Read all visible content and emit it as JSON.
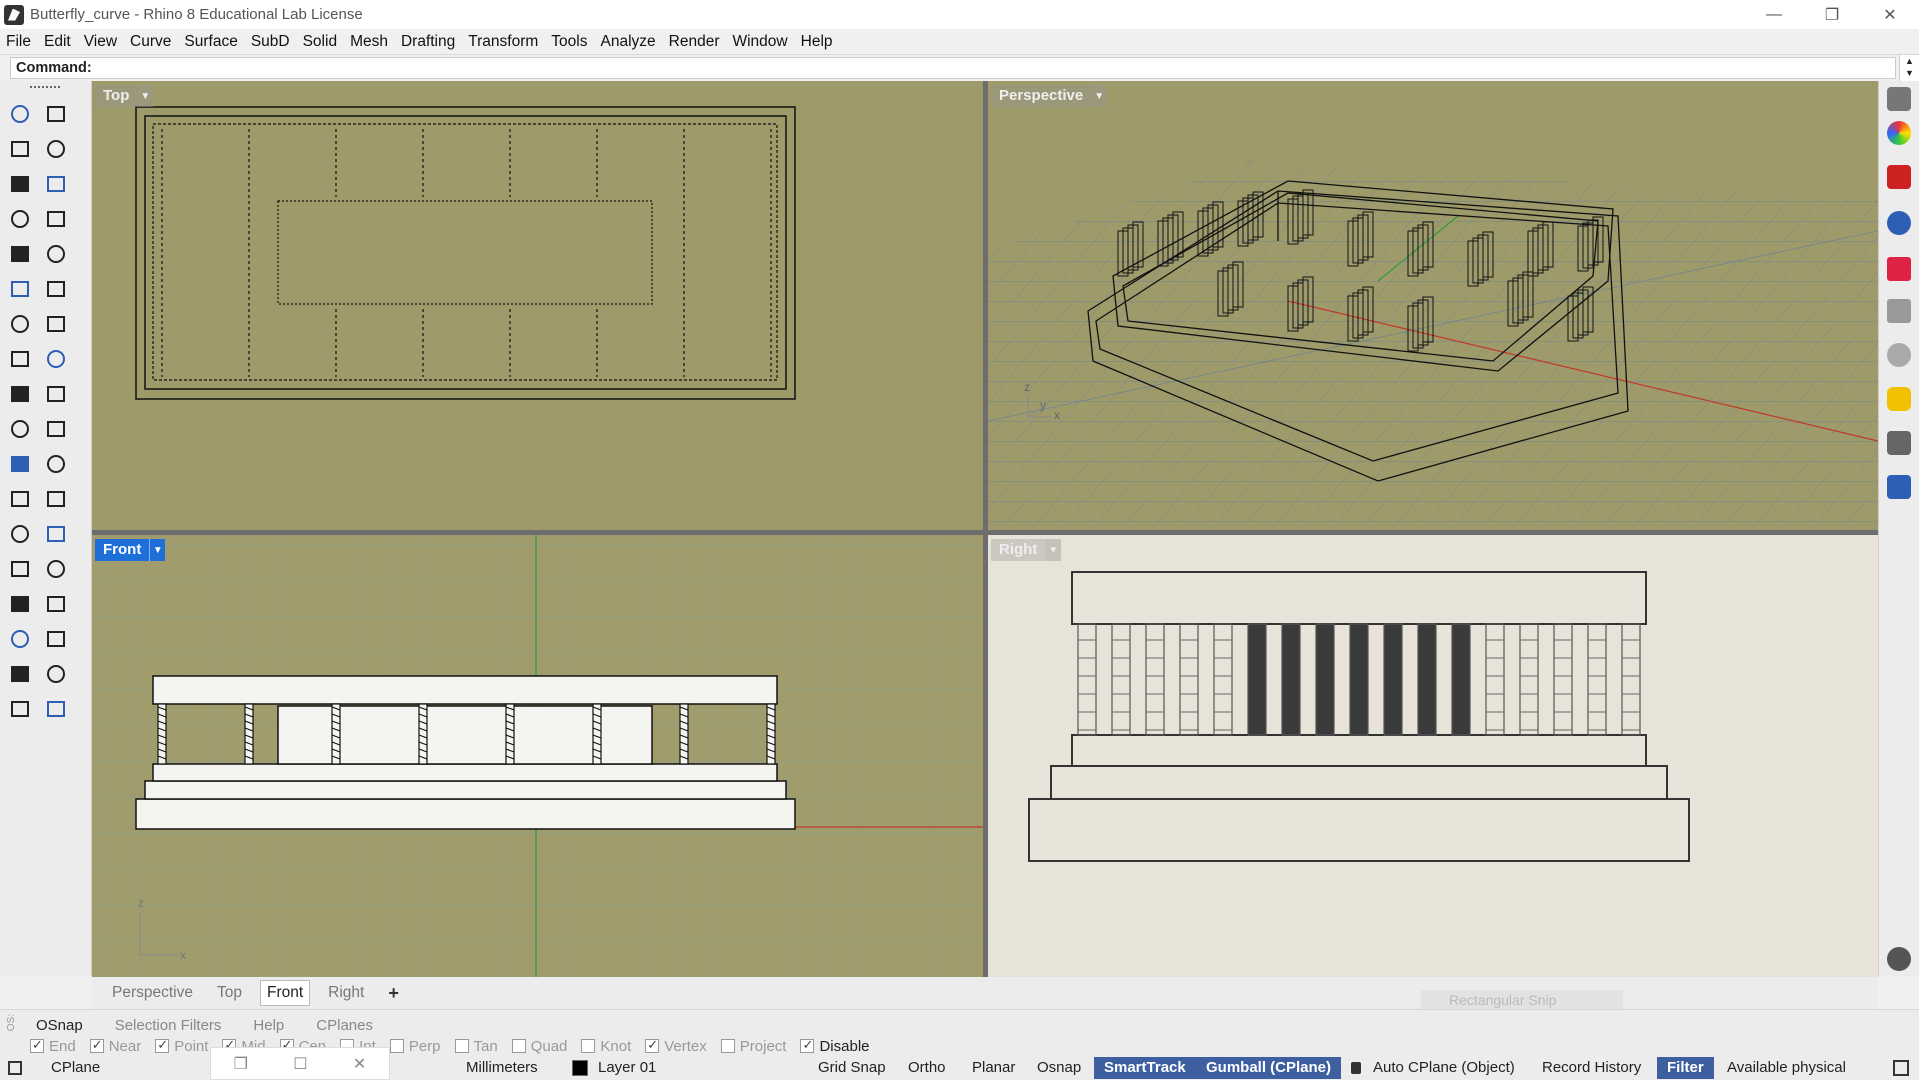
{
  "window": {
    "title": "Butterfly_curve - Rhino 8 Educational Lab License",
    "controls": [
      "—",
      "❐",
      "✕"
    ]
  },
  "menu": [
    "File",
    "Edit",
    "View",
    "Curve",
    "Surface",
    "SubD",
    "Solid",
    "Mesh",
    "Drafting",
    "Transform",
    "Tools",
    "Analyze",
    "Render",
    "Window",
    "Help"
  ],
  "command": {
    "label": "Command:",
    "value": ""
  },
  "viewports": {
    "top": {
      "label": "Top",
      "active": false
    },
    "perspective": {
      "label": "Perspective",
      "active": false
    },
    "front": {
      "label": "Front",
      "active": true
    },
    "right": {
      "label": "Right",
      "active": false
    },
    "axes": {
      "z": "z",
      "y": "y",
      "x": "x"
    }
  },
  "viewport_tabs": {
    "items": [
      "Perspective",
      "Top",
      "Front",
      "Right"
    ],
    "active": "Front",
    "add": "+"
  },
  "osnap_panel": {
    "side_label": "OS:",
    "tabs": [
      "OSnap",
      "Selection Filters",
      "Help",
      "CPlanes"
    ],
    "active_tab": "OSnap",
    "snaps": [
      {
        "label": "End",
        "checked": true
      },
      {
        "label": "Near",
        "checked": true
      },
      {
        "label": "Point",
        "checked": true
      },
      {
        "label": "Mid",
        "checked": true
      },
      {
        "label": "Cen",
        "checked": true
      },
      {
        "label": "Int",
        "checked": false
      },
      {
        "label": "Perp",
        "checked": false
      },
      {
        "label": "Tan",
        "checked": false
      },
      {
        "label": "Quad",
        "checked": false
      },
      {
        "label": "Knot",
        "checked": false
      },
      {
        "label": "Vertex",
        "checked": true
      },
      {
        "label": "Project",
        "checked": false
      },
      {
        "label": "Disable",
        "checked": true
      }
    ]
  },
  "floating_snip": {
    "label": "Rectangular Snip"
  },
  "status": {
    "cplane": "CPlane",
    "units": "Millimeters",
    "layer": "Layer 01",
    "grid_snap": "Grid Snap",
    "ortho": "Ortho",
    "planar": "Planar",
    "osnap": "Osnap",
    "smarttrack": "SmartTrack",
    "gumball": "Gumball (CPlane)",
    "auto_cplane": "Auto CPlane (Object)",
    "record_history": "Record History",
    "filter": "Filter",
    "memory": "Available physical"
  },
  "colors": {
    "viewport_bg": "#9f9a6a",
    "active_label": "#1e6fd9",
    "status_pill": "#3e5fa0",
    "right_view_bg": "#e8e3d8"
  }
}
